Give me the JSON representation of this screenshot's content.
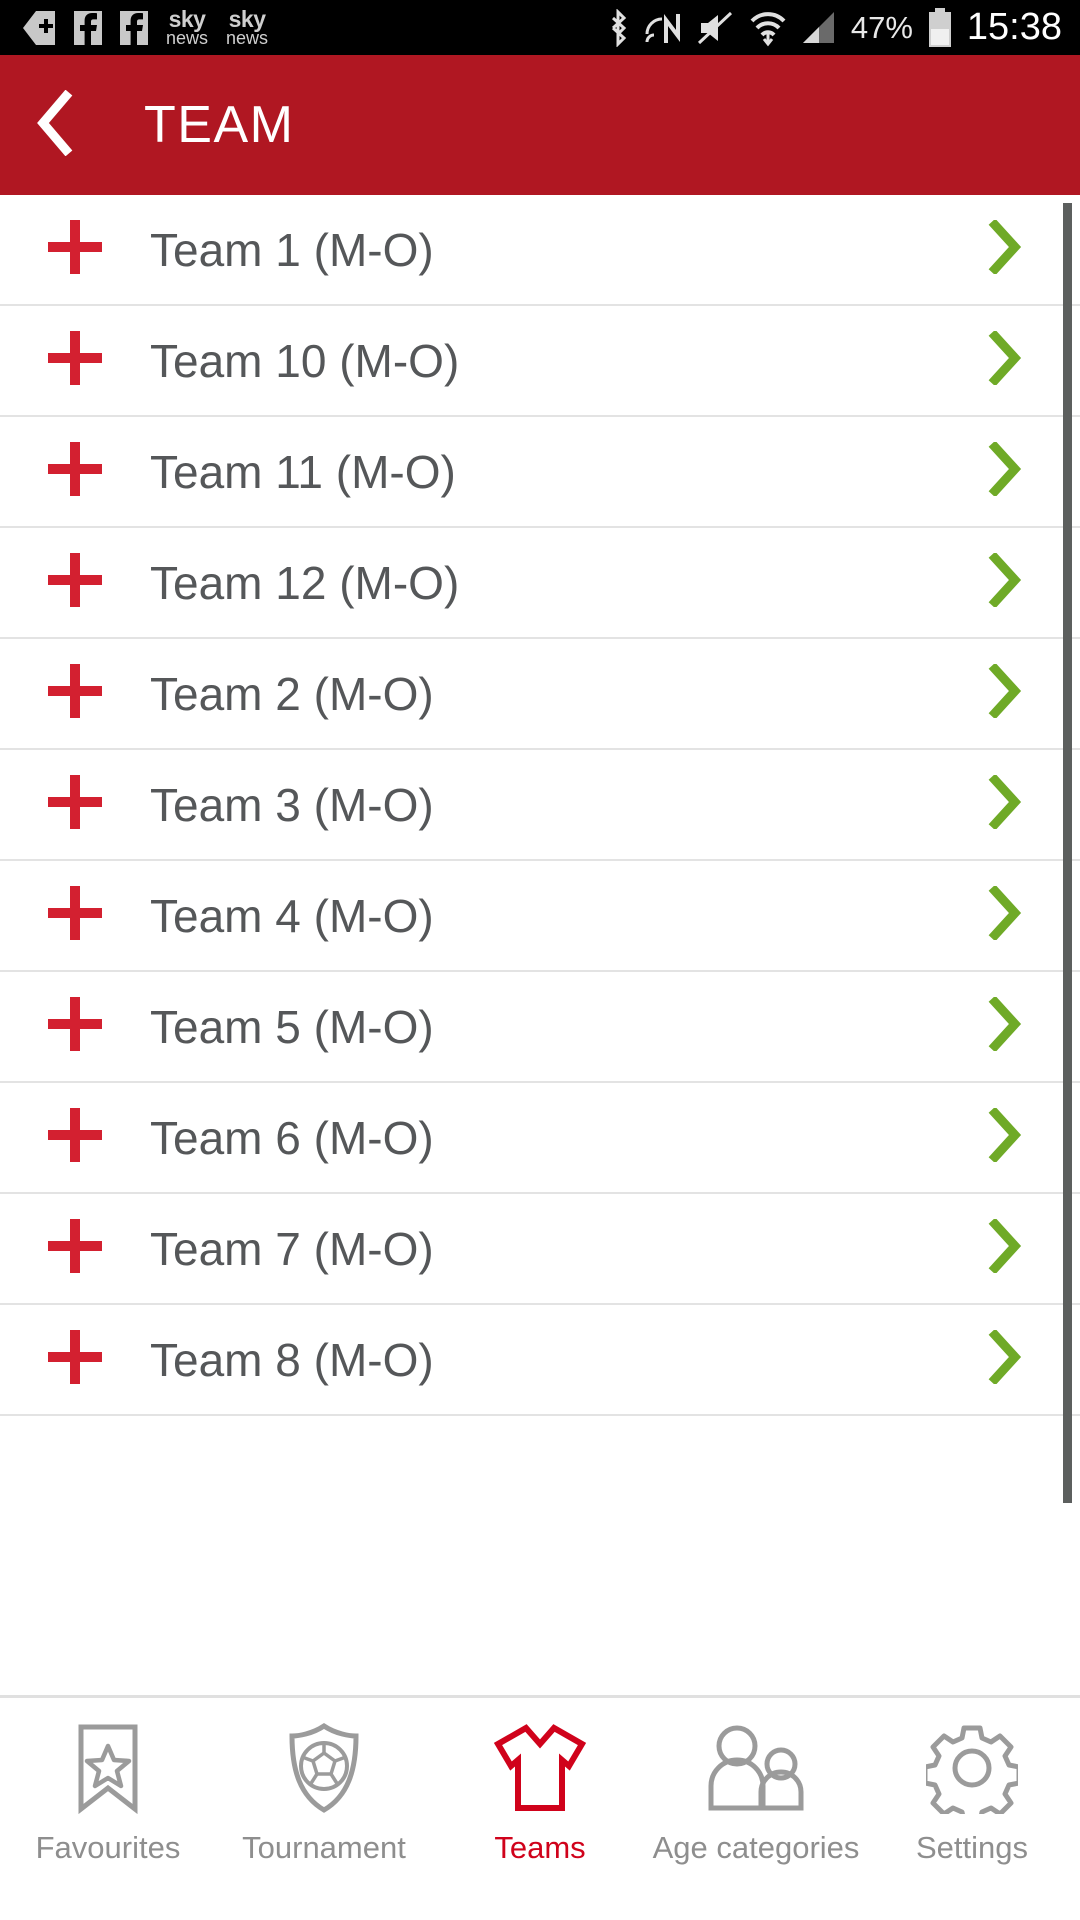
{
  "statusbar": {
    "icons_left": [
      "navigation-app-icon",
      "facebook-icon",
      "facebook-icon",
      "sky-news-icon",
      "sky-news-icon"
    ],
    "sky_line1": "sky",
    "sky_line2": "news",
    "icons_right": [
      "bluetooth-icon",
      "nfc-icon",
      "mute-icon",
      "wifi-icon",
      "cellular-signal-icon"
    ],
    "battery_percent": "47%",
    "battery_icon": "battery-icon",
    "time": "15:38"
  },
  "header": {
    "back_icon": "back-chevron-icon",
    "title": "TEAM",
    "background_color": "#B01722"
  },
  "list": {
    "plus_icon": "plus-icon",
    "chevron_icon": "chevron-right-icon",
    "plus_color": "#D32030",
    "chevron_color": "#6FAA27",
    "rows": [
      {
        "label": "Team 1 (M-O)"
      },
      {
        "label": "Team 10 (M-O)"
      },
      {
        "label": "Team 11 (M-O)"
      },
      {
        "label": "Team 12 (M-O)"
      },
      {
        "label": "Team 2 (M-O)"
      },
      {
        "label": "Team 3 (M-O)"
      },
      {
        "label": "Team 4 (M-O)"
      },
      {
        "label": "Team 5 (M-O)"
      },
      {
        "label": "Team 6 (M-O)"
      },
      {
        "label": "Team 7 (M-O)"
      },
      {
        "label": "Team 8 (M-O)"
      }
    ],
    "scrollbar": "vertical-scrollbar"
  },
  "tabbar": {
    "active_color": "#D0021B",
    "inactive_color": "#8e8e8e",
    "tabs": [
      {
        "label": "Favourites",
        "icon": "bookmark-star-icon",
        "active": false
      },
      {
        "label": "Tournament",
        "icon": "shield-ball-icon",
        "active": false
      },
      {
        "label": "Teams",
        "icon": "jersey-icon",
        "active": true
      },
      {
        "label": "Age categories",
        "icon": "people-icon",
        "active": false
      },
      {
        "label": "Settings",
        "icon": "gear-icon",
        "active": false
      }
    ]
  }
}
